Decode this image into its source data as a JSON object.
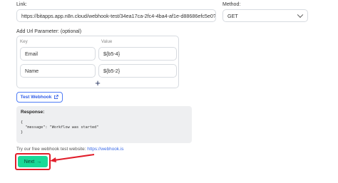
{
  "link": {
    "label": "Link:",
    "value": "https://bitapps.app.n8n.cloud/webhook-test/34ea17ca-2fc4-4ba4-af1e-d88686efc5e0?Em"
  },
  "method": {
    "label": "Method:",
    "value": "GET"
  },
  "params": {
    "label": "Add Url Parameter: (optional)",
    "key_header": "Key",
    "value_header": "Value",
    "rows": [
      {
        "key": "Email",
        "value": "${b5-4}"
      },
      {
        "key": "Name",
        "value": "${b5-2}"
      }
    ],
    "add_symbol": "+"
  },
  "test_button": {
    "label": "Test Webhook"
  },
  "response": {
    "title": "Response:",
    "body_lines": [
      "{",
      "  \"message\": \"Workflow was started\"",
      "}"
    ]
  },
  "hint": {
    "text": "Try our free webhook test website:",
    "link": "https://webhook.is"
  },
  "next_button": {
    "label": "Next",
    "arrow": "→"
  },
  "colors": {
    "accent_green": "#19d997",
    "highlight_red": "#e11d2a",
    "link_blue": "#3b6ae8"
  }
}
